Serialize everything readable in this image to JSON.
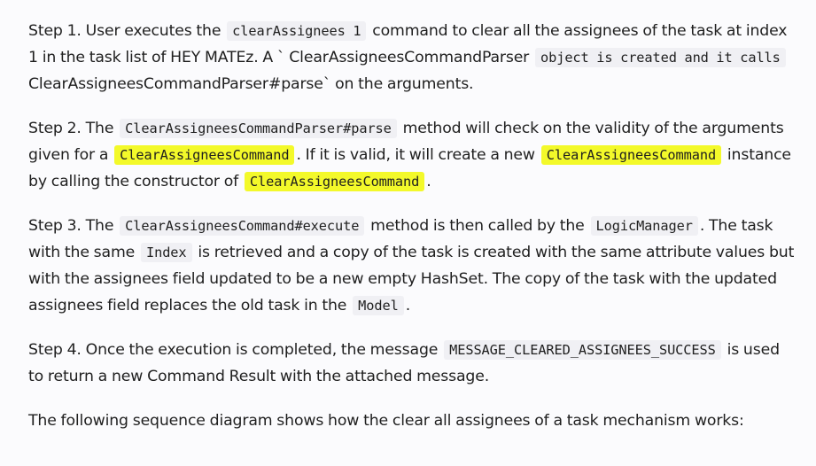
{
  "step1": {
    "t1": "Step 1. User executes the ",
    "c1": "clearAssignees 1",
    "t2": " command to clear all the assignees of the task at index 1 in the task list of HEY MATEz. A ` ClearAssigneesCommandParser ",
    "c2": "object is created and it calls",
    "t3": " ClearAssigneesCommandParser#parse` on the arguments."
  },
  "step2": {
    "t1": "Step 2. The ",
    "c1": "ClearAssigneesCommandParser#parse",
    "t2": " method will check on the validity of the arguments given for a ",
    "c2": "ClearAssigneesCommand",
    "t3": ". If it is valid, it will create a new ",
    "c3": "ClearAssigneesCommand",
    "t4": " instance by calling the constructor of ",
    "c4": "ClearAssigneesCommand",
    "t5": "."
  },
  "step3": {
    "t1": "Step 3. The ",
    "c1": "ClearAssigneesCommand#execute",
    "t2": " method is then called by the ",
    "c2": "LogicManager",
    "t3": ". The task with the same ",
    "c3": "Index",
    "t4": " is retrieved and a copy of the task is created with the same attribute values but with the assignees field updated to be a new empty HashSet. The copy of the task with the updated assignees field replaces the old task in the ",
    "c4": "Model",
    "t5": "."
  },
  "step4": {
    "t1": "Step 4. Once the execution is completed, the message ",
    "c1": "MESSAGE_CLEARED_ASSIGNEES_SUCCESS",
    "t2": " is used to return a new Command Result with the attached message."
  },
  "closing": "The following sequence diagram shows how the clear all assignees of a task mechanism works:",
  "colors": {
    "highlight": "#f3f92a",
    "code_bg": "#f0f0f4"
  }
}
